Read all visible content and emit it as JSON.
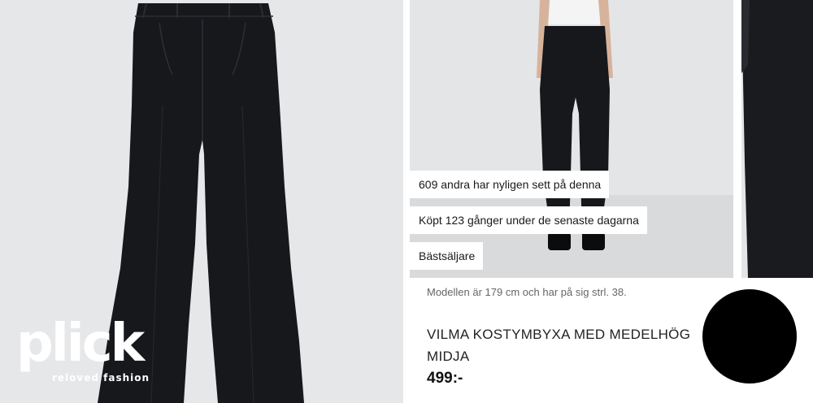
{
  "brand": {
    "logo_text": "plick",
    "tagline": "reloved fashion"
  },
  "badges": [
    "609 andra har nyligen sett på denna",
    "Köpt 123 gånger under de senaste dagarna",
    "Bästsäljare"
  ],
  "product": {
    "model_info": "Modellen är 179 cm och har på sig strl. 38.",
    "title": "VILMA KOSTYMBYXA MED MEDELHÖG MIDJA",
    "price": "499:-"
  },
  "images": {
    "main": "black-flared-trousers",
    "model": "model-wearing-trousers",
    "detail": "trouser-leg-closeup"
  },
  "colors": {
    "trouser": "#17181c",
    "photo_background": "#e6e7e9",
    "badge_background": "#ffffff",
    "redaction_circle": "#000000"
  }
}
